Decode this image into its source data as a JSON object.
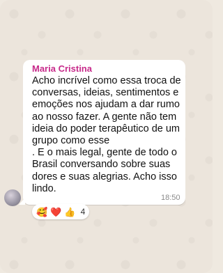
{
  "message": {
    "sender": "Maria Cristina",
    "lines": [
      "Acho incrível como essa troca de",
      "conversas, ideias, sentimentos e",
      "emoções  nos ajudam a dar rumo",
      "ao nosso fazer. A gente não tem",
      "ideia do poder terapêutico de um",
      "grupo como esse",
      ". E o mais legal, gente de todo o",
      "Brasil conversando sobre suas",
      "dores e suas alegrias. Acho isso",
      "lindo."
    ],
    "time": "18:50"
  },
  "reactions": {
    "emojis": [
      "🥰",
      "❤️",
      "👍"
    ],
    "count": "4"
  },
  "colors": {
    "sender": "#c72a8a",
    "background": "#ece5dc",
    "bubble": "#ffffff"
  }
}
